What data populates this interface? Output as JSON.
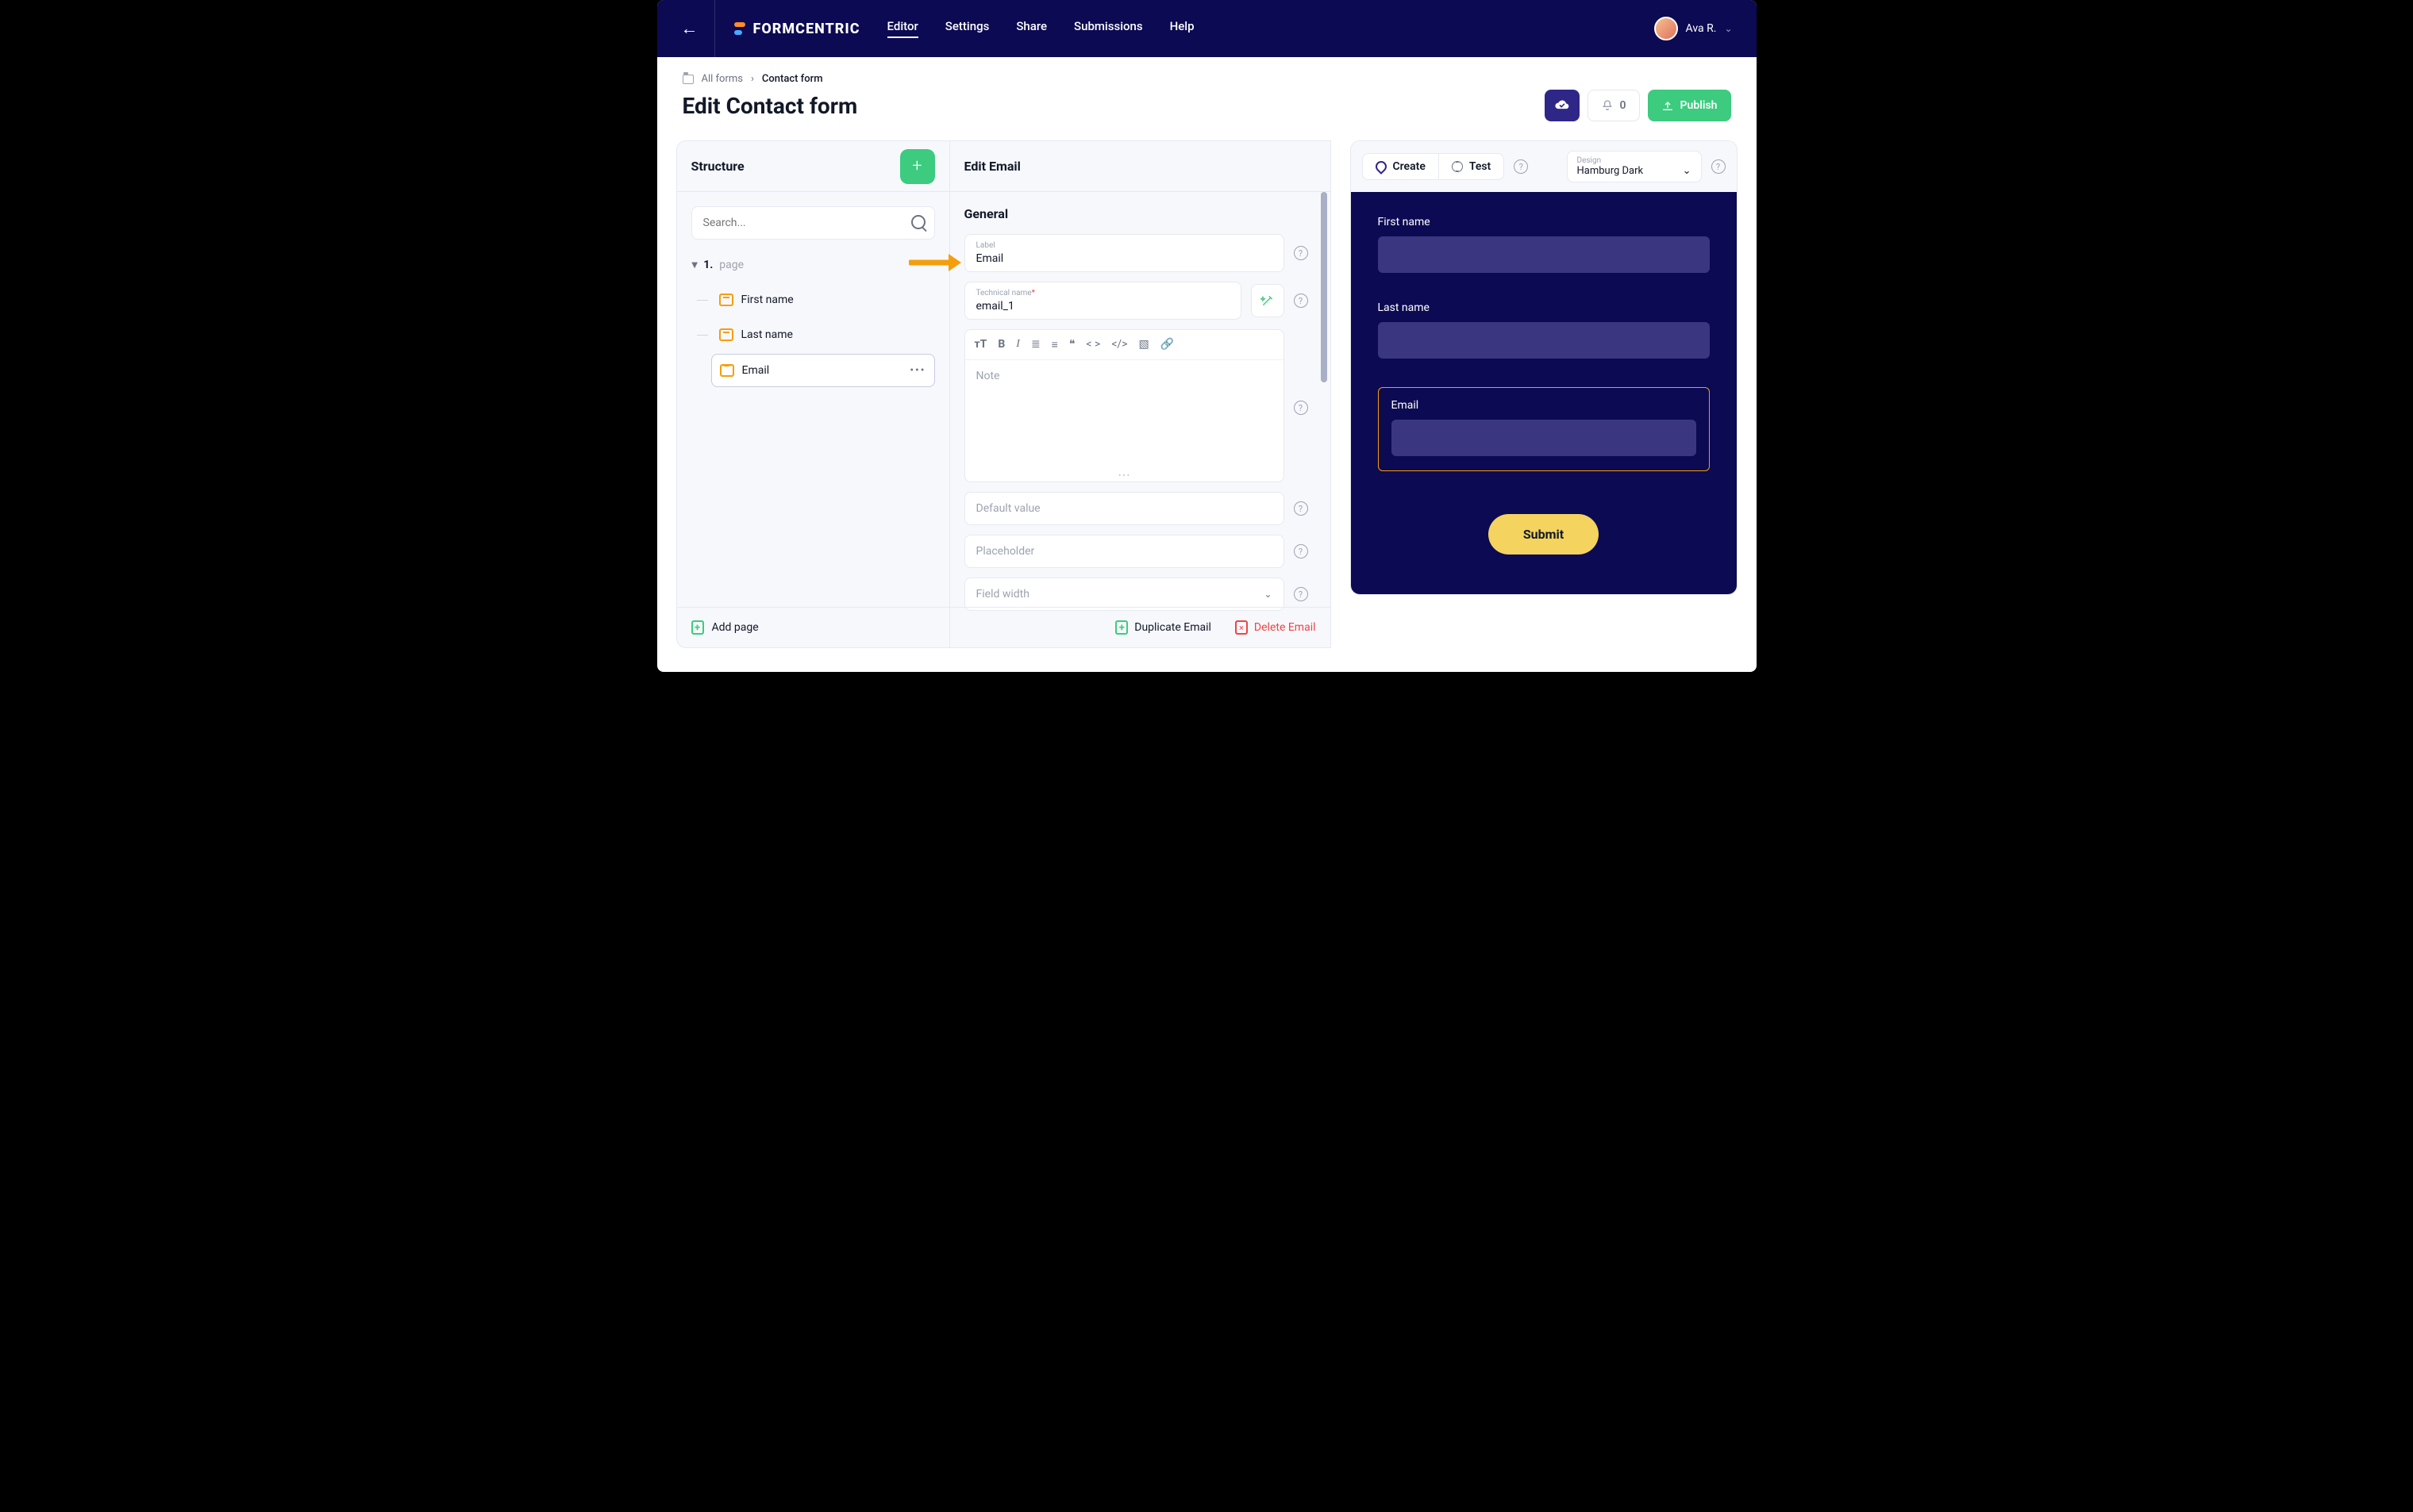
{
  "nav": {
    "items": [
      "Editor",
      "Settings",
      "Share",
      "Submissions",
      "Help"
    ],
    "active": "Editor",
    "logo": "FORMCENTRIC"
  },
  "user": {
    "name": "Ava R."
  },
  "breadcrumb": {
    "root": "All forms",
    "current": "Contact form"
  },
  "page_title": "Edit Contact form",
  "toolbar": {
    "bell_count": "0",
    "publish": "Publish"
  },
  "structure": {
    "title": "Structure",
    "search_placeholder": "Search...",
    "page": {
      "number": "1.",
      "label": "page"
    },
    "items": [
      {
        "label": "First name"
      },
      {
        "label": "Last name"
      },
      {
        "label": "Email",
        "selected": true
      }
    ],
    "add_page": "Add page"
  },
  "editpanel": {
    "title": "Edit Email",
    "section": "General",
    "label_caption": "Label",
    "label_value": "Email",
    "tech_caption": "Technical name",
    "tech_value": "email_1",
    "note_placeholder": "Note",
    "default_placeholder": "Default value",
    "placeholder_placeholder": "Placeholder",
    "fieldwidth_placeholder": "Field width",
    "duplicate": "Duplicate Email",
    "delete": "Delete Email"
  },
  "preview": {
    "create": "Create",
    "test": "Test",
    "design_label": "Design",
    "design_value": "Hamburg Dark",
    "fields": [
      {
        "label": "First name"
      },
      {
        "label": "Last name"
      },
      {
        "label": "Email",
        "active": true
      }
    ],
    "submit": "Submit"
  }
}
